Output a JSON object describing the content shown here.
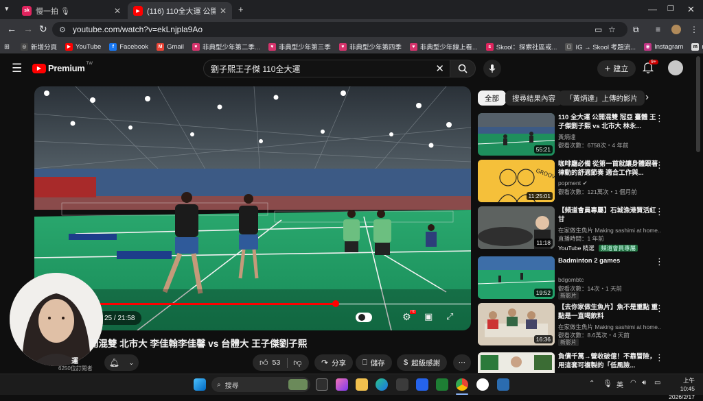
{
  "browser": {
    "tabs": [
      {
        "title": "慢一拍 🎙",
        "active": false
      },
      {
        "title": "(116) 110全大運 公開混雙 北市",
        "active": true
      }
    ],
    "new_tab": "+",
    "url": "youtube.com/watch?v=ekLnjpla9Ao",
    "bookmarks": [
      "新增分頁",
      "YouTube",
      "Facebook",
      "Gmail",
      "非典型少年第二季...",
      "非典型少年第三季",
      "非典型少年第四季",
      "非典型少年線上看...",
      "Skool：探索社區或...",
      "IG → Skool 考題流...",
      "Instagram",
      "manychat"
    ]
  },
  "youtube": {
    "logo": "Premium",
    "logo_sup": "TW",
    "search_query": "劉子熙王子傑 110全大運",
    "create_label": "建立",
    "notif_count": "9+"
  },
  "video": {
    "time": "25 / 21:58",
    "progress": 0.69,
    "title": "開混雙 北市大 李佳翰李佳馨 vs 台體大 王子傑劉子熙",
    "channel_suffix": "運",
    "subscribers": "6250位訂閱者",
    "likes": "53",
    "share": "分享",
    "save": "儲存",
    "thanks": "超級感謝",
    "hd_badge": "HD"
  },
  "chips": [
    "全部",
    "搜尋結果內容",
    "「黃炳達」上傳的影片"
  ],
  "recommendations": [
    {
      "title": "110 全大運 公開混雙 冠亞 臺體 王子傑劉子熙 vs 北市大 林永...",
      "channel": "黃炳達",
      "meta": "觀看次數：6758次・4 年前",
      "duration": "55:21",
      "badge": ""
    },
    {
      "title": "咖啡廳必備 從第一首就讓身體跟著律動的舒適節奏 適合工作與...",
      "channel": "popment",
      "meta": "觀看次數：121萬次・1 個月前",
      "duration": "11:25:01",
      "badge": ""
    },
    {
      "title": "【頻道會員專屬】石城漁港買活紅甘",
      "channel": "在家做生魚片 Making sashimi at home...",
      "meta": "直播時間：1 年前",
      "duration": "11:18",
      "badge": "YouTube 精選",
      "badge2": "頻道會員專屬"
    },
    {
      "title": "Badminton 2 games",
      "channel": "bdgombtc",
      "meta": "觀看次數：14次・1 天前",
      "duration": "19:52",
      "badge": "新影片"
    },
    {
      "title": "【去你家做生魚片】魚不是重點 重點是一直喝飲料",
      "channel": "在家做生魚片 Making sashimi at home...",
      "meta": "觀看次數：8.6萬次・4 天前",
      "duration": "16:36",
      "badge": "新影片"
    },
    {
      "title": "負債千萬→營收破億！不靠冒險，用這套可複製的「低風險...",
      "channel": "",
      "meta": "",
      "duration": "",
      "badge": ""
    }
  ],
  "taskbar": {
    "search_placeholder": "搜尋",
    "ime": "英",
    "time": "上午 10:45",
    "date": "2026/2/17"
  },
  "colors": {
    "accent": "#ff0000",
    "court": "#1f9a63",
    "bg": "#0f0f0f"
  }
}
